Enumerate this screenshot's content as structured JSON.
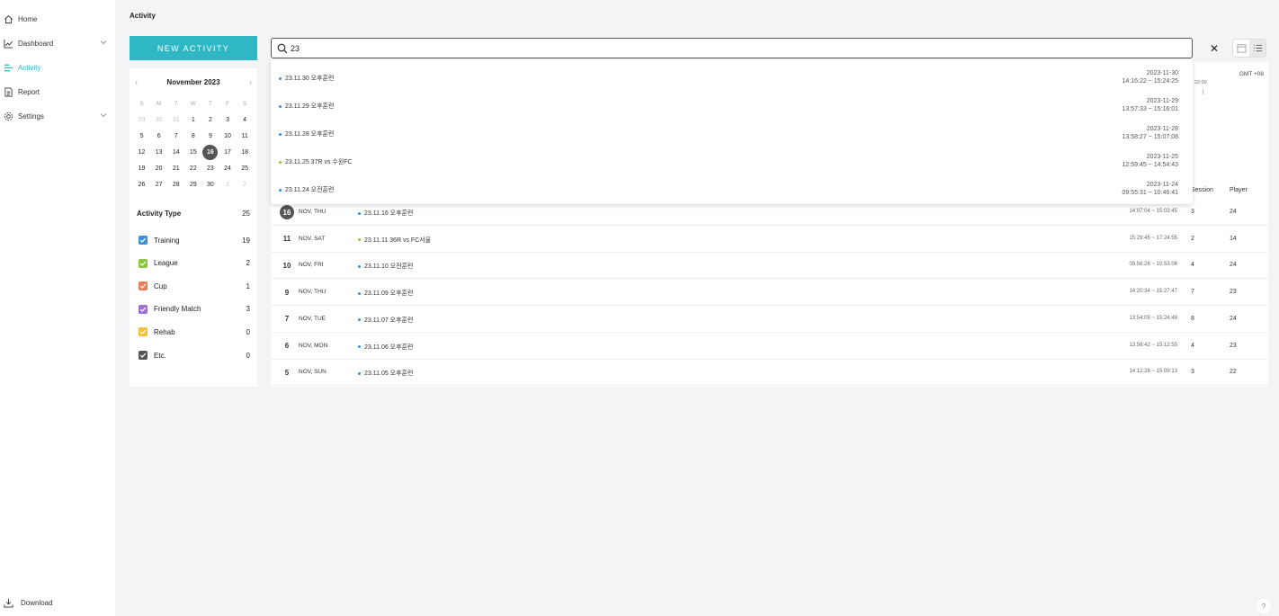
{
  "sidebar": {
    "items": [
      {
        "label": "Home",
        "active": false
      },
      {
        "label": "Dashboard",
        "active": false
      },
      {
        "label": "Activity",
        "active": true
      },
      {
        "label": "Report",
        "active": false
      },
      {
        "label": "Settings",
        "active": false
      }
    ],
    "download_label": "Download"
  },
  "header": {
    "title": "Activity"
  },
  "new_activity_label": "NEW ACTIVITY",
  "search": {
    "value": "23"
  },
  "calendar": {
    "month_label": "November 2023",
    "weekdays": [
      "S",
      "M",
      "T",
      "W",
      "T",
      "F",
      "S"
    ],
    "weeks": [
      [
        "29",
        "30",
        "31",
        "1",
        "2",
        "3",
        "4"
      ],
      [
        "5",
        "6",
        "7",
        "8",
        "9",
        "10",
        "11"
      ],
      [
        "12",
        "13",
        "14",
        "15",
        "16",
        "17",
        "18"
      ],
      [
        "19",
        "20",
        "21",
        "22",
        "23",
        "24",
        "25"
      ],
      [
        "26",
        "27",
        "28",
        "29",
        "30",
        "1",
        "2"
      ]
    ],
    "selected_day": "16"
  },
  "activity_type": {
    "label": "Activity Type",
    "total": "25",
    "items": [
      {
        "label": "Training",
        "count": "19",
        "color": "#3d8fd6"
      },
      {
        "label": "League",
        "count": "2",
        "color": "#8bc43f"
      },
      {
        "label": "Cup",
        "count": "1",
        "color": "#f07c5a"
      },
      {
        "label": "Friendly Match",
        "count": "3",
        "color": "#9b6fd6"
      },
      {
        "label": "Rehab",
        "count": "0",
        "color": "#f1c232"
      },
      {
        "label": "Etc.",
        "count": "0",
        "color": "#555555"
      }
    ]
  },
  "timeline": {
    "timezone": "GMT +08",
    "tick": "22:00"
  },
  "table": {
    "headers": {
      "session": "Session",
      "player": "Player"
    },
    "rows": [
      {
        "day": "16",
        "dow": "NOV, THU",
        "title": "23.11.16 오후훈련",
        "dot": "#3d8fd6",
        "time": "14:07:04 ~ 15:03:45",
        "session": "3",
        "player": "24",
        "today": true
      },
      {
        "day": "11",
        "dow": "NOV, SAT",
        "title": "23.11.11 36R vs FC서울",
        "dot": "#8bc43f",
        "time": "15:29:45 ~ 17:24:55",
        "session": "2",
        "player": "14",
        "today": false
      },
      {
        "day": "10",
        "dow": "NOV, FRI",
        "title": "23.11.10 오전훈련",
        "dot": "#3d8fd6",
        "time": "09:56:26 ~ 10:53:06",
        "session": "4",
        "player": "24",
        "today": false
      },
      {
        "day": "9",
        "dow": "NOV, THU",
        "title": "23.11.09 오후훈련",
        "dot": "#3d8fd6",
        "time": "14:20:34 ~ 15:27:47",
        "session": "7",
        "player": "23",
        "today": false
      },
      {
        "day": "7",
        "dow": "NOV, TUE",
        "title": "23.11.07 오후훈련",
        "dot": "#3d8fd6",
        "time": "13:54:05 ~ 15:24:48",
        "session": "8",
        "player": "24",
        "today": false
      },
      {
        "day": "6",
        "dow": "NOV, MON",
        "title": "23.11.06 오후훈련",
        "dot": "#3d8fd6",
        "time": "13:56:42 ~ 15:12:55",
        "session": "4",
        "player": "23",
        "today": false
      },
      {
        "day": "5",
        "dow": "NOV, SUN",
        "title": "23.11.05 오후훈련",
        "dot": "#3d8fd6",
        "time": "14:12:26 ~ 15:09:13",
        "session": "3",
        "player": "22",
        "today": false
      }
    ]
  },
  "search_results": [
    {
      "name": "23.11.30 오후훈련",
      "dot": "#3d8fd6",
      "date": "2023-11-30",
      "time": "14:16:22 ~ 15:24:25"
    },
    {
      "name": "23.11.29 오후훈련",
      "dot": "#3d8fd6",
      "date": "2023-11-29",
      "time": "13:57:33 ~ 15:16:01"
    },
    {
      "name": "23.11.28 오후훈련",
      "dot": "#3d8fd6",
      "date": "2023-11-28",
      "time": "13:58:27 ~ 15:07:08"
    },
    {
      "name": "23.11.25 37R vs 수원FC",
      "dot": "#8bc43f",
      "date": "2023-11-25",
      "time": "12:59:45 ~ 14:54:43"
    },
    {
      "name": "23.11.24 오전훈련",
      "dot": "#3d8fd6",
      "date": "2023-11-24",
      "time": "09:55:31 ~ 10:46:41"
    }
  ],
  "help_label": "?"
}
